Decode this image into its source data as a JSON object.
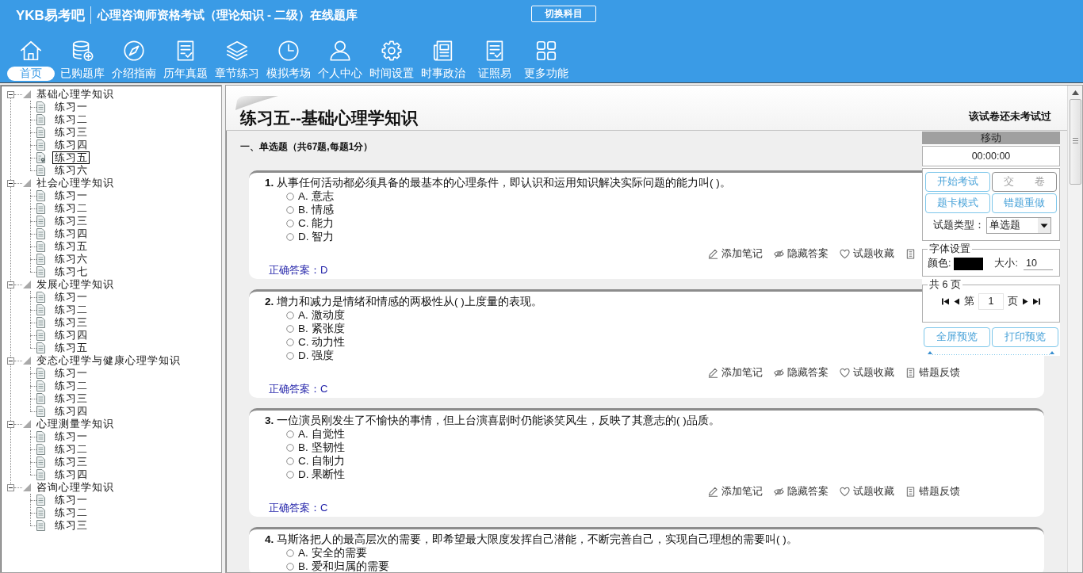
{
  "header": {
    "logo": "YKB易考吧",
    "title": "心理咨询师资格考试（理论知识 - 二级）在线题库",
    "switch_button": "切换科目"
  },
  "toolbar": [
    {
      "kind": "home",
      "label": "首页",
      "selected": true
    },
    {
      "kind": "bank",
      "label": "已购题库",
      "selected": false
    },
    {
      "kind": "guide",
      "label": "介绍指南",
      "selected": false
    },
    {
      "kind": "papers",
      "label": "历年真题",
      "selected": false
    },
    {
      "kind": "chapters",
      "label": "章节练习",
      "selected": false
    },
    {
      "kind": "exam",
      "label": "模拟考场",
      "selected": false
    },
    {
      "kind": "profile",
      "label": "个人中心",
      "selected": false
    },
    {
      "kind": "settings",
      "label": "时间设置",
      "selected": false
    },
    {
      "kind": "news",
      "label": "时事政治",
      "selected": false
    },
    {
      "kind": "certificate",
      "label": "证照易",
      "selected": false
    },
    {
      "kind": "more",
      "label": "更多功能",
      "selected": false
    }
  ],
  "tree": [
    {
      "label": "基础心理学知识",
      "expanded": true,
      "children": [
        {
          "label": "练习一",
          "selected": false
        },
        {
          "label": "练习二",
          "selected": false
        },
        {
          "label": "练习三",
          "selected": false
        },
        {
          "label": "练习四",
          "selected": false
        },
        {
          "label": "练习五",
          "selected": true
        },
        {
          "label": "练习六",
          "selected": false
        }
      ]
    },
    {
      "label": "社会心理学知识",
      "expanded": true,
      "children": [
        {
          "label": "练习一",
          "selected": false
        },
        {
          "label": "练习二",
          "selected": false
        },
        {
          "label": "练习三",
          "selected": false
        },
        {
          "label": "练习四",
          "selected": false
        },
        {
          "label": "练习五",
          "selected": false
        },
        {
          "label": "练习六",
          "selected": false
        },
        {
          "label": "练习七",
          "selected": false
        }
      ]
    },
    {
      "label": "发展心理学知识",
      "expanded": true,
      "children": [
        {
          "label": "练习一",
          "selected": false
        },
        {
          "label": "练习二",
          "selected": false
        },
        {
          "label": "练习三",
          "selected": false
        },
        {
          "label": "练习四",
          "selected": false
        },
        {
          "label": "练习五",
          "selected": false
        }
      ]
    },
    {
      "label": "变态心理学与健康心理学知识",
      "expanded": true,
      "children": [
        {
          "label": "练习一",
          "selected": false
        },
        {
          "label": "练习二",
          "selected": false
        },
        {
          "label": "练习三",
          "selected": false
        },
        {
          "label": "练习四",
          "selected": false
        }
      ]
    },
    {
      "label": "心理测量学知识",
      "expanded": true,
      "children": [
        {
          "label": "练习一",
          "selected": false
        },
        {
          "label": "练习二",
          "selected": false
        },
        {
          "label": "练习三",
          "selected": false
        },
        {
          "label": "练习四",
          "selected": false
        }
      ]
    },
    {
      "label": "咨询心理学知识",
      "expanded": true,
      "children": [
        {
          "label": "练习一",
          "selected": false
        },
        {
          "label": "练习二",
          "selected": false
        },
        {
          "label": "练习三",
          "selected": false
        }
      ]
    }
  ],
  "content": {
    "title": "练习五--基础心理学知识",
    "status": "该试卷还未考试过",
    "section": "一、单选题（共67题,每题1分）",
    "questions": [
      {
        "number": "1.",
        "text": "从事任何活动都必须具备的最基本的心理条件，即认识和运用知识解决实际问题的能力叫( )。",
        "options": [
          {
            "text": "A. 意志",
            "selected": false
          },
          {
            "text": "B. 情感",
            "selected": false
          },
          {
            "text": "C. 能力",
            "selected": false
          },
          {
            "text": "D. 智力",
            "selected": false
          }
        ],
        "actions": [
          {
            "kind": "note",
            "label": "添加笔记"
          },
          {
            "kind": "hide",
            "label": "隐藏答案"
          },
          {
            "kind": "favorite",
            "label": "试题收藏"
          },
          {
            "kind": "feedback"
          }
        ],
        "answer": "正确答案：D"
      },
      {
        "number": "2.",
        "text": "增力和减力是情绪和情感的两极性从( )上度量的表现。",
        "options": [
          {
            "text": "A. 激动度",
            "selected": false
          },
          {
            "text": "B. 紧张度",
            "selected": false
          },
          {
            "text": "C. 动力性",
            "selected": false
          },
          {
            "text": "D. 强度",
            "selected": false
          }
        ],
        "actions": [
          {
            "kind": "note",
            "label": "添加笔记"
          },
          {
            "kind": "hide",
            "label": "隐藏答案"
          },
          {
            "kind": "favorite",
            "label": "试题收藏"
          },
          {
            "kind": "feedback",
            "label": "错题反馈"
          }
        ],
        "answer": "正确答案：C"
      },
      {
        "number": "3.",
        "text": "一位演员刚发生了不愉快的事情，但上台演喜剧时仍能谈笑风生，反映了其意志的( )品质。",
        "options": [
          {
            "text": "A. 自觉性",
            "selected": false
          },
          {
            "text": "B. 坚韧性",
            "selected": false
          },
          {
            "text": "C. 自制力",
            "selected": false
          },
          {
            "text": "D. 果断性",
            "selected": false
          }
        ],
        "actions": [
          {
            "kind": "note",
            "label": "添加笔记"
          },
          {
            "kind": "hide",
            "label": "隐藏答案"
          },
          {
            "kind": "favorite",
            "label": "试题收藏"
          },
          {
            "kind": "feedback",
            "label": "错题反馈"
          }
        ],
        "answer": "正确答案：C"
      },
      {
        "number": "4.",
        "text": "马斯洛把人的最高层次的需要，即希望最大限度发挥自己潜能，不断完善自己，实现自己理想的需要叫( )。",
        "options": [
          {
            "text": "A. 安全的需要",
            "selected": false
          },
          {
            "text": "B. 爱和归属的需要",
            "selected": false
          }
        ]
      }
    ]
  },
  "panel": {
    "handle": "移动",
    "timer": "00:00:00",
    "buttons": [
      {
        "label": "开始考试",
        "disabled": false
      },
      {
        "label": "交　　卷",
        "disabled": true
      },
      {
        "label": "题卡模式",
        "disabled": false
      },
      {
        "label": "错题重做",
        "disabled": false
      }
    ],
    "type_label": "试题类型：",
    "type_value": "单选题",
    "font": {
      "legend": "字体设置",
      "color_label": "颜色:",
      "color": "#000000",
      "size_label": "大小:",
      "size": "10"
    },
    "pages": {
      "legend": "共 6 页",
      "prefix": "第",
      "page": "1",
      "suffix": "页"
    },
    "preview_buttons": [
      "全屏预览",
      "打印预览"
    ]
  }
}
